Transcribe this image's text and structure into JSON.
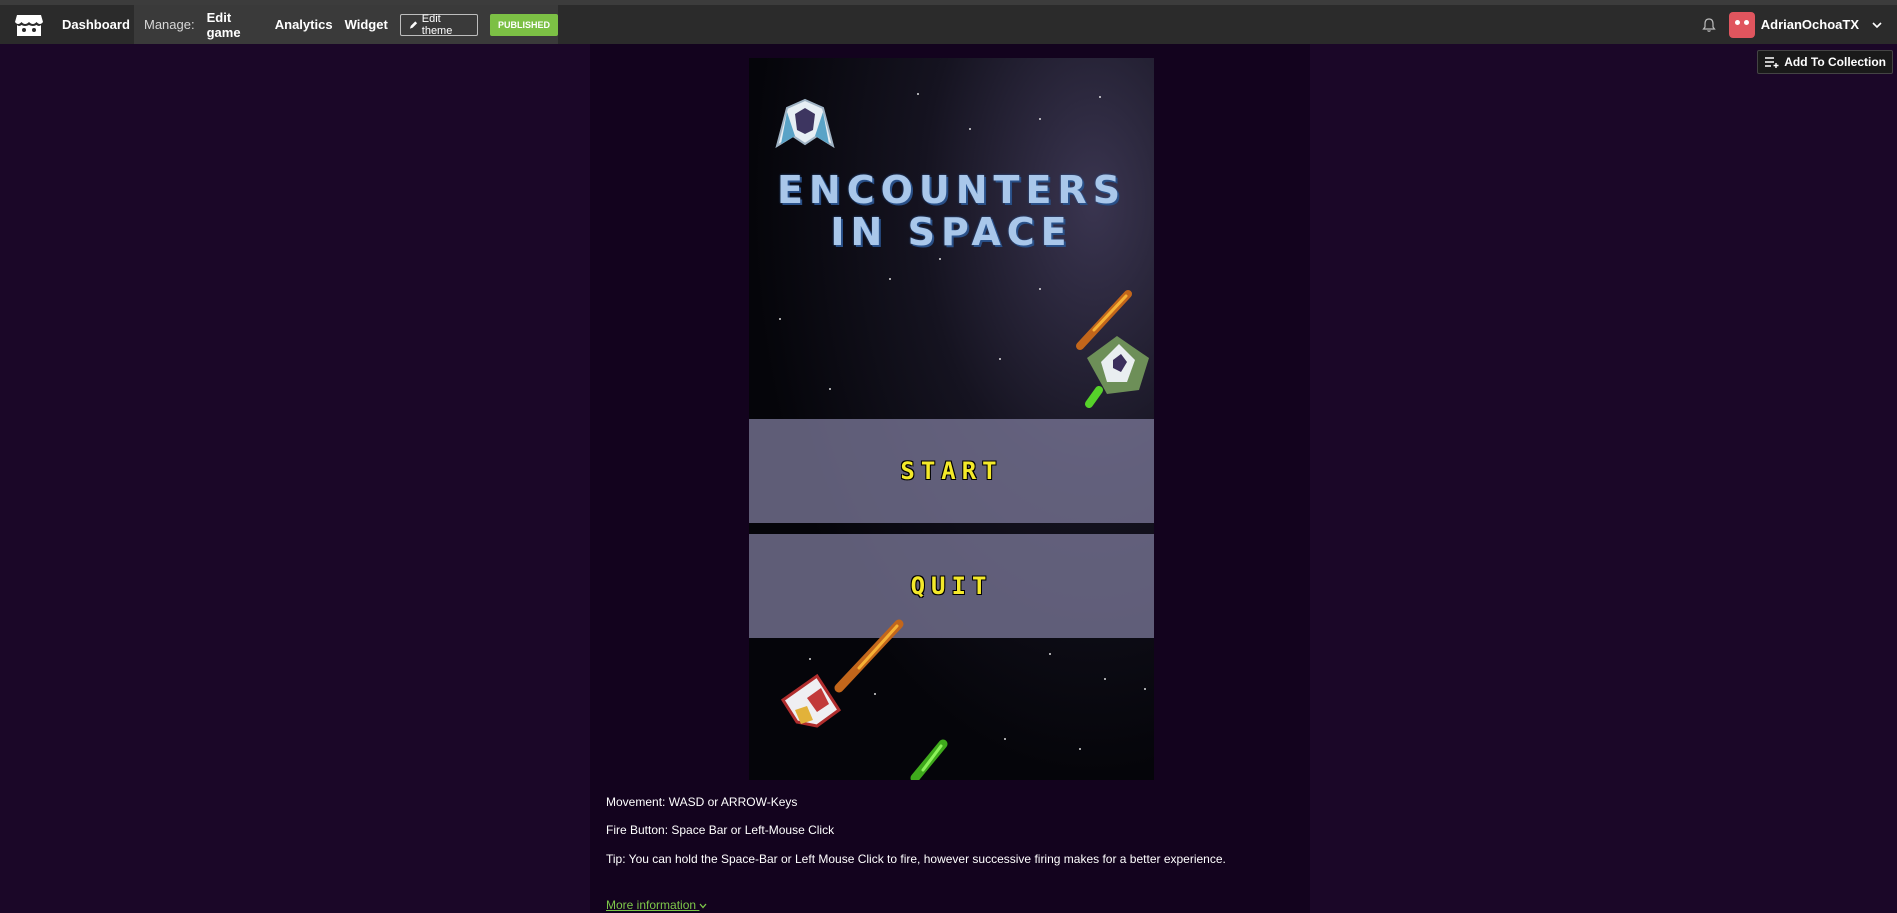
{
  "topbar": {
    "dashboard_label": "Dashboard",
    "manage_label": "Manage:",
    "links": [
      "Edit game",
      "Analytics",
      "Widget"
    ],
    "edit_theme_label": "Edit theme",
    "published_label": "PUBLISHED",
    "username": "AdrianOchoaTX"
  },
  "add_to_collection_label": "Add To Collection",
  "game": {
    "title_line1": "ENCOUNTERS",
    "title_line2": "IN SPACE",
    "start_label": "START",
    "quit_label": "QUIT"
  },
  "description": {
    "line1": "Movement: WASD or ARROW-Keys",
    "line2": "Fire Button: Space Bar or Left-Mouse Click",
    "line3": "Tip: You can hold the Space-Bar or Left Mouse Click to fire, however successive firing makes for a better experience."
  },
  "more_info_label": "More information",
  "colors": {
    "page_bg": "#1b0728",
    "column_bg": "#13031e",
    "published_green": "#7cc045",
    "title_blue": "#a9c7ea",
    "button_yellow": "#f4e92a",
    "link_green": "#7ec84a"
  }
}
